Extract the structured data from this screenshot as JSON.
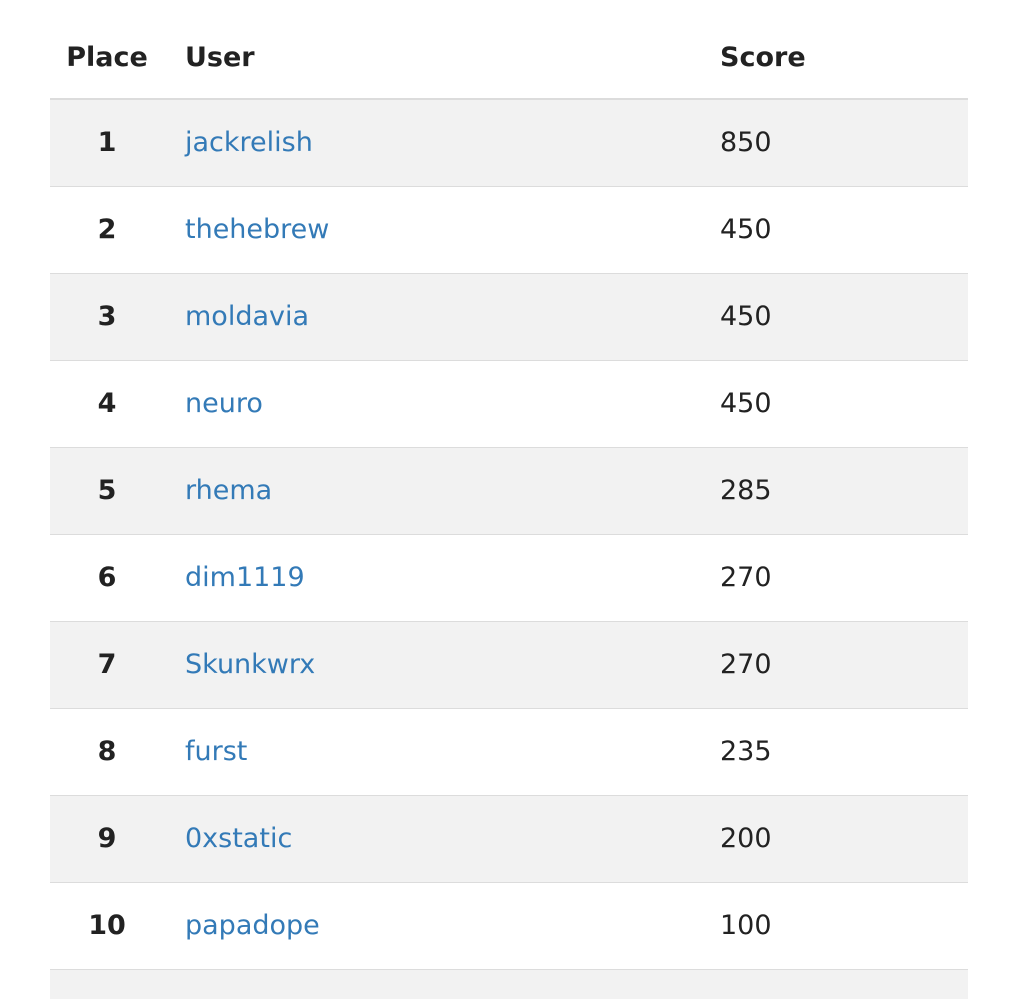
{
  "leaderboard": {
    "headers": {
      "place": "Place",
      "user": "User",
      "score": "Score"
    },
    "rows": [
      {
        "place": "1",
        "user": "jackrelish",
        "score": "850"
      },
      {
        "place": "2",
        "user": "thehebrew",
        "score": "450"
      },
      {
        "place": "3",
        "user": "moldavia",
        "score": "450"
      },
      {
        "place": "4",
        "user": "neuro",
        "score": "450"
      },
      {
        "place": "5",
        "user": "rhema",
        "score": "285"
      },
      {
        "place": "6",
        "user": "dim1119",
        "score": "270"
      },
      {
        "place": "7",
        "user": "Skunkwrx",
        "score": "270"
      },
      {
        "place": "8",
        "user": "furst",
        "score": "235"
      },
      {
        "place": "9",
        "user": "0xstatic",
        "score": "200"
      },
      {
        "place": "10",
        "user": "papadope",
        "score": "100"
      }
    ]
  },
  "colors": {
    "link": "#337ab7",
    "text": "#222222",
    "stripe": "#f2f2f2",
    "border": "#dcdcdc"
  }
}
